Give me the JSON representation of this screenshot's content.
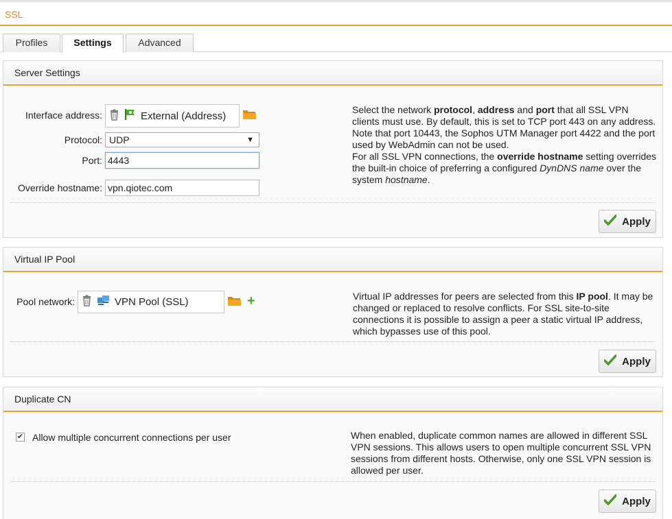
{
  "title": "SSL",
  "tabs": [
    {
      "label": "Profiles"
    },
    {
      "label": "Settings"
    },
    {
      "label": "Advanced"
    }
  ],
  "apply_label": "Apply",
  "server_settings": {
    "header": "Server Settings",
    "interface_label": "Interface address:",
    "interface_value": "External (Address)",
    "protocol_label": "Protocol:",
    "protocol_value": "UDP",
    "port_label": "Port:",
    "port_value": "4443",
    "hostname_label": "Override hostname:",
    "hostname_value": "vpn.qiotec.com",
    "help": {
      "p1_a": "Select the network ",
      "p1_b": "protocol",
      "p1_c": ", ",
      "p1_d": "address",
      "p1_e": " and ",
      "p1_f": "port",
      "p1_g": " that all SSL VPN clients must use. By default, this is set to TCP port 443 on any address. Note that port 10443, the Sophos UTM Manager port 4422 and the port used by WebAdmin can not be used.",
      "p2_a": "For all SSL VPN connections, the ",
      "p2_b": "override hostname",
      "p2_c": " setting overrides the built-in choice of preferring a configured ",
      "p2_d": "DynDNS name",
      "p2_e": " over the system ",
      "p2_f": "hostname",
      "p2_g": "."
    }
  },
  "virtual_ip_pool": {
    "header": "Virtual IP Pool",
    "pool_label": "Pool network:",
    "pool_value": "VPN Pool (SSL)",
    "help_a": "Virtual IP addresses for peers are selected from this ",
    "help_b": "IP pool",
    "help_c": ". It may be changed or replaced to resolve conflicts. For SSL site-to-site connections it is possible to assign a peer a static virtual IP address, which bypasses use of this pool."
  },
  "duplicate_cn": {
    "header": "Duplicate CN",
    "checkbox_label": "Allow multiple concurrent connections per user",
    "checked": true,
    "help": "When enabled, duplicate common names are allowed in different SSL VPN sessions. This allows users to open multiple concurrent SSL VPN sessions from different hosts. Otherwise, only one SSL VPN session is allowed per user."
  },
  "colors": {
    "accent": "#f0a030",
    "title": "#e08a1e",
    "check_green": "#4f9a2a"
  }
}
